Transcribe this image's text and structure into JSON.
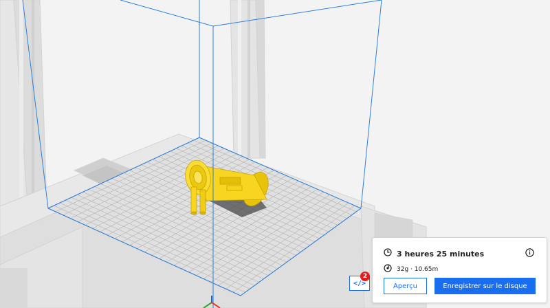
{
  "viewport": {
    "build_volume_color": "#2a7fe0",
    "model_color": "#f7d520",
    "grid_color": "#bcbcbc"
  },
  "gcode_button": {
    "icon": "code-icon",
    "glyph": "</>",
    "badge": "2"
  },
  "print_panel": {
    "time": "3 heures 25 minutes",
    "material": "32g · 10.65m",
    "time_icon": "clock-icon",
    "material_icon": "spool-icon",
    "info_icon": "info-icon",
    "preview_label": "Aperçu",
    "save_label": "Enregistrer sur le disque",
    "accent": "#196ef0"
  }
}
